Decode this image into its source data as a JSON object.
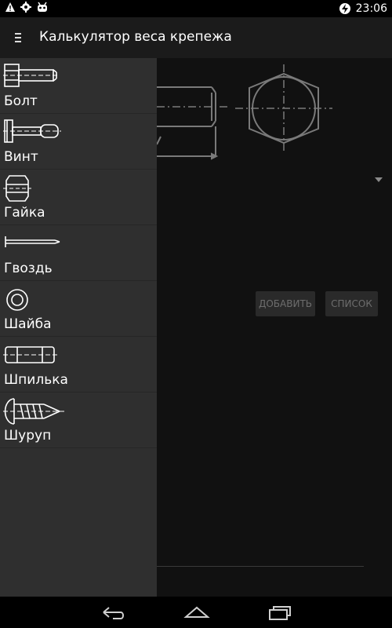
{
  "status_bar": {
    "time": "23:06",
    "left_icons": [
      "warning-icon",
      "settings-icon",
      "android-icon"
    ],
    "right_icons": [
      "battery-charging-icon"
    ]
  },
  "action_bar": {
    "title": "Калькулятор веса крепежа"
  },
  "drawer": {
    "items": [
      {
        "label": "Болт",
        "icon": "bolt-icon"
      },
      {
        "label": "Винт",
        "icon": "screw-icon"
      },
      {
        "label": "Гайка",
        "icon": "nut-icon"
      },
      {
        "label": "Гвоздь",
        "icon": "nail-icon"
      },
      {
        "label": "Шайба",
        "icon": "washer-icon"
      },
      {
        "label": "Шпилька",
        "icon": "stud-icon"
      },
      {
        "label": "Шуруп",
        "icon": "wood-screw-icon"
      }
    ]
  },
  "content": {
    "add_label": "ДОБАВИТЬ",
    "list_label": "СПИСОК"
  },
  "nav_bar": {
    "buttons": [
      "back-icon",
      "home-icon",
      "recents-icon"
    ]
  },
  "colors": {
    "background": "#111111",
    "drawer": "#2f2f2f",
    "action_bar": "#1b1b1b",
    "drawing_lines": "#7a7a7a"
  }
}
